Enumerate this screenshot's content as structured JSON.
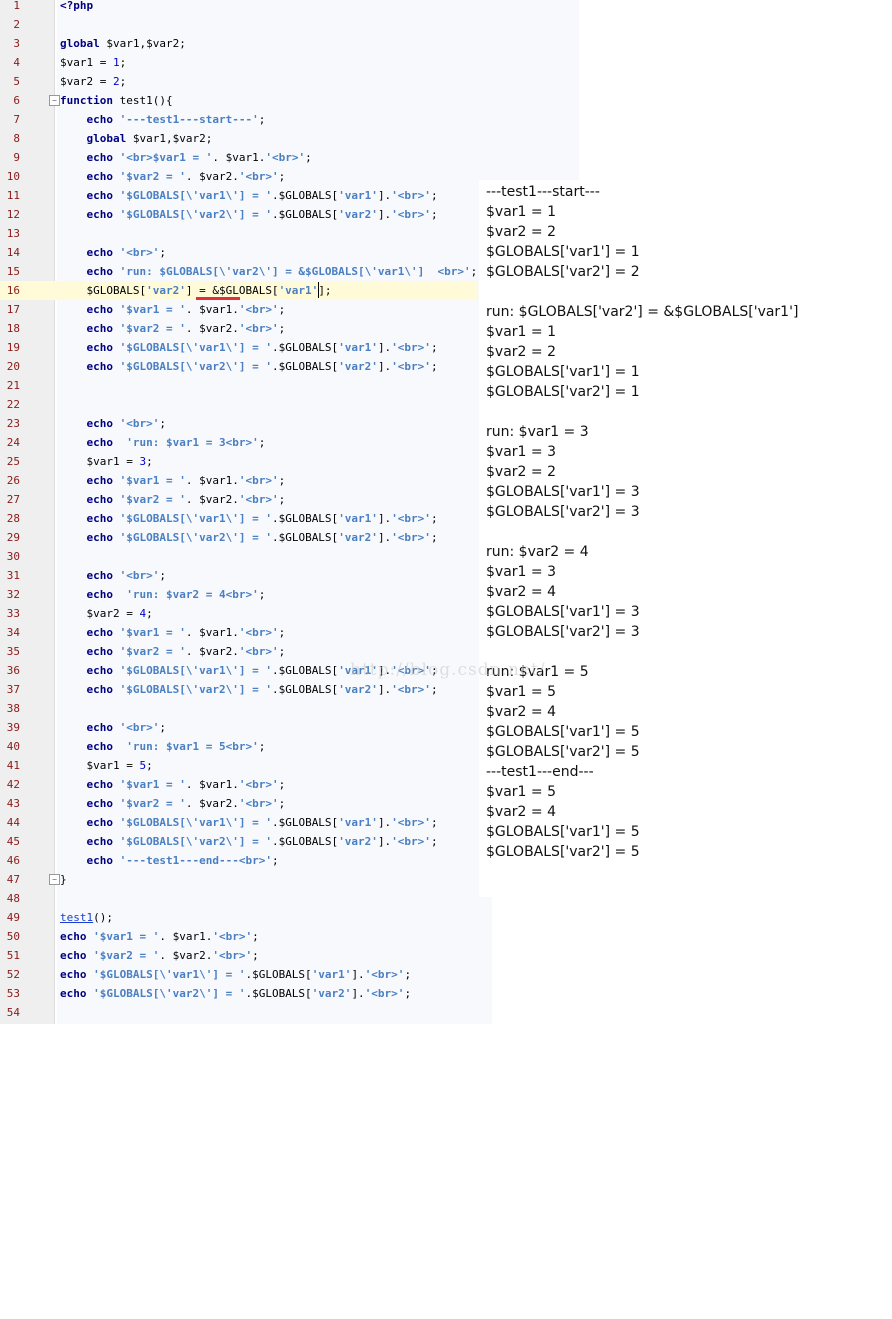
{
  "editor": {
    "lines": [
      {
        "n": "1",
        "t": "<?php"
      },
      {
        "n": "2",
        "t": ""
      },
      {
        "n": "3",
        "t": "global $var1,$var2;"
      },
      {
        "n": "4",
        "t": "$var1 = 1;"
      },
      {
        "n": "5",
        "t": "$var2 = 2;"
      },
      {
        "n": "6",
        "t": "function test1(){"
      },
      {
        "n": "7",
        "t": "    echo '---test1---start---';"
      },
      {
        "n": "8",
        "t": "    global $var1,$var2;"
      },
      {
        "n": "9",
        "t": "    echo '<br>$var1 = '. $var1.'<br>';"
      },
      {
        "n": "10",
        "t": "    echo '$var2 = '. $var2.'<br>';"
      },
      {
        "n": "11",
        "t": "    echo '$GLOBALS[\\'var1\\'] = '.$GLOBALS['var1'].'<br>';"
      },
      {
        "n": "12",
        "t": "    echo '$GLOBALS[\\'var2\\'] = '.$GLOBALS['var2'].'<br>';"
      },
      {
        "n": "13",
        "t": ""
      },
      {
        "n": "14",
        "t": "    echo '<br>';"
      },
      {
        "n": "15",
        "t": "    echo 'run: $GLOBALS[\\'var2\\'] = &$GLOBALS[\\'var1\\']  <br>';"
      },
      {
        "n": "16",
        "t": "    $GLOBALS['var2'] = &$GLOBALS['var1'];"
      },
      {
        "n": "17",
        "t": "    echo '$var1 = '. $var1.'<br>';"
      },
      {
        "n": "18",
        "t": "    echo '$var2 = '. $var2.'<br>';"
      },
      {
        "n": "19",
        "t": "    echo '$GLOBALS[\\'var1\\'] = '.$GLOBALS['var1'].'<br>';"
      },
      {
        "n": "20",
        "t": "    echo '$GLOBALS[\\'var2\\'] = '.$GLOBALS['var2'].'<br>';"
      },
      {
        "n": "21",
        "t": ""
      },
      {
        "n": "22",
        "t": ""
      },
      {
        "n": "23",
        "t": "    echo '<br>';"
      },
      {
        "n": "24",
        "t": "    echo  'run: $var1 = 3<br>';"
      },
      {
        "n": "25",
        "t": "    $var1 = 3;"
      },
      {
        "n": "26",
        "t": "    echo '$var1 = '. $var1.'<br>';"
      },
      {
        "n": "27",
        "t": "    echo '$var2 = '. $var2.'<br>';"
      },
      {
        "n": "28",
        "t": "    echo '$GLOBALS[\\'var1\\'] = '.$GLOBALS['var1'].'<br>';"
      },
      {
        "n": "29",
        "t": "    echo '$GLOBALS[\\'var2\\'] = '.$GLOBALS['var2'].'<br>';"
      },
      {
        "n": "30",
        "t": ""
      },
      {
        "n": "31",
        "t": "    echo '<br>';"
      },
      {
        "n": "32",
        "t": "    echo  'run: $var2 = 4<br>';"
      },
      {
        "n": "33",
        "t": "    $var2 = 4;"
      },
      {
        "n": "34",
        "t": "    echo '$var1 = '. $var1.'<br>';"
      },
      {
        "n": "35",
        "t": "    echo '$var2 = '. $var2.'<br>';"
      },
      {
        "n": "36",
        "t": "    echo '$GLOBALS[\\'var1\\'] = '.$GLOBALS['var1'].'<br>';"
      },
      {
        "n": "37",
        "t": "    echo '$GLOBALS[\\'var2\\'] = '.$GLOBALS['var2'].'<br>';"
      },
      {
        "n": "38",
        "t": ""
      },
      {
        "n": "39",
        "t": "    echo '<br>';"
      },
      {
        "n": "40",
        "t": "    echo  'run: $var1 = 5<br>';"
      },
      {
        "n": "41",
        "t": "    $var1 = 5;"
      },
      {
        "n": "42",
        "t": "    echo '$var1 = '. $var1.'<br>';"
      },
      {
        "n": "43",
        "t": "    echo '$var2 = '. $var2.'<br>';"
      },
      {
        "n": "44",
        "t": "    echo '$GLOBALS[\\'var1\\'] = '.$GLOBALS['var1'].'<br>';"
      },
      {
        "n": "45",
        "t": "    echo '$GLOBALS[\\'var2\\'] = '.$GLOBALS['var2'].'<br>';"
      },
      {
        "n": "46",
        "t": "    echo '---test1---end---<br>';"
      },
      {
        "n": "47",
        "t": "}"
      },
      {
        "n": "48",
        "t": ""
      },
      {
        "n": "49",
        "t": "test1();"
      },
      {
        "n": "50",
        "t": "echo '$var1 = '. $var1.'<br>';"
      },
      {
        "n": "51",
        "t": "echo '$var2 = '. $var2.'<br>';"
      },
      {
        "n": "52",
        "t": "echo '$GLOBALS[\\'var1\\'] = '.$GLOBALS['var1'].'<br>';"
      },
      {
        "n": "53",
        "t": "echo '$GLOBALS[\\'var2\\'] = '.$GLOBALS['var2'].'<br>';"
      },
      {
        "n": "54",
        "t": ""
      }
    ],
    "current_line": "16",
    "fold_markers": [
      "6",
      "47"
    ]
  },
  "output": {
    "lines": [
      "---test1---start---",
      "$var1 = 1",
      "$var2 = 2",
      "$GLOBALS['var1'] = 1",
      "$GLOBALS['var2'] = 2",
      "",
      "run: $GLOBALS['var2'] = &$GLOBALS['var1']",
      "$var1 = 1",
      "$var2 = 2",
      "$GLOBALS['var1'] = 1",
      "$GLOBALS['var2'] = 1",
      "",
      "run: $var1 = 3",
      "$var1 = 3",
      "$var2 = 2",
      "$GLOBALS['var1'] = 3",
      "$GLOBALS['var2'] = 3",
      "",
      "run: $var2 = 4",
      "$var1 = 3",
      "$var2 = 4",
      "$GLOBALS['var1'] = 3",
      "$GLOBALS['var2'] = 3",
      "",
      "run: $var1 = 5",
      "$var1 = 5",
      "$var2 = 4",
      "$GLOBALS['var1'] = 5",
      "$GLOBALS['var2'] = 5",
      "---test1---end---",
      "$var1 = 5",
      "$var2 = 4",
      "$GLOBALS['var1'] = 5",
      "$GLOBALS['var2'] = 5"
    ]
  },
  "watermark": "http://blog.csdn.net/",
  "colors": {
    "keyword": "#000080",
    "string": "#4a7fc2",
    "line_number": "#8b1a1a",
    "current_line_bg": "#fffbd8",
    "error_underline": "#e0303a"
  }
}
